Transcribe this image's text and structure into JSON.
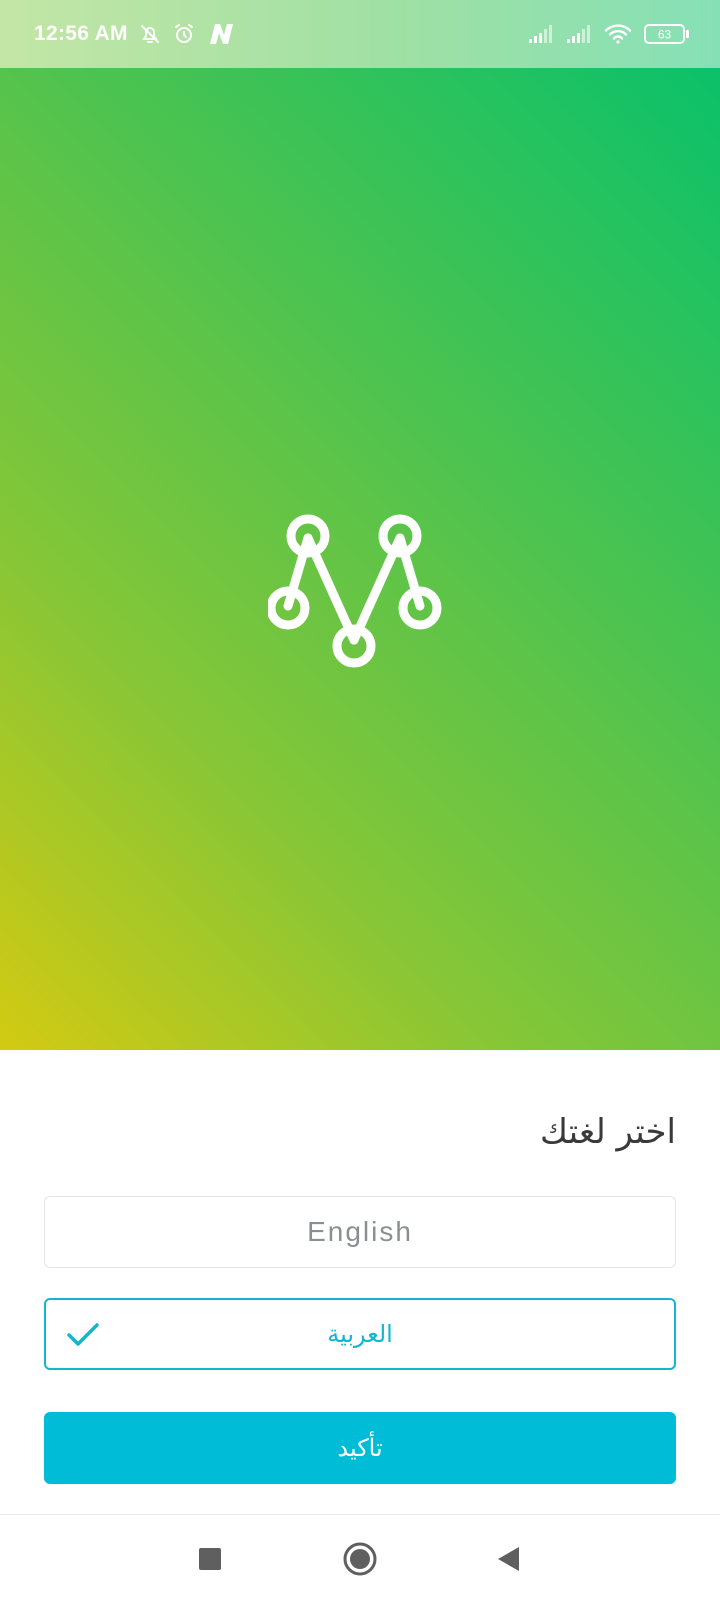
{
  "status_bar": {
    "time": "12:56 AM",
    "battery_level": "63",
    "icons": [
      "mute-icon",
      "alarm-icon",
      "n-app-icon",
      "signal-icon",
      "signal-icon",
      "wifi-icon",
      "battery-icon"
    ]
  },
  "hero": {
    "logo_icon": "network-m-logo-icon",
    "gradient_colors": [
      "#0bc16a",
      "#51c34e",
      "#86c637",
      "#d3ca12"
    ]
  },
  "language_panel": {
    "title": "اختر لغتك",
    "options": [
      {
        "label": "English",
        "selected": false
      },
      {
        "label": "العربية",
        "selected": true
      }
    ],
    "confirm_label": "تأكيد",
    "accent_color": "#00bcd6"
  },
  "nav_bar": {
    "icons": [
      "recents-icon",
      "home-icon",
      "back-icon"
    ]
  }
}
